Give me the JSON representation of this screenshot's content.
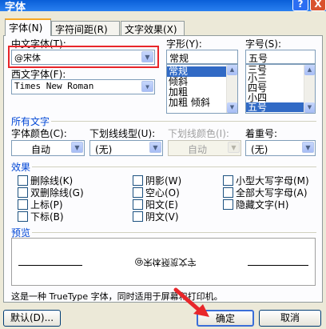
{
  "window": {
    "title": "字体",
    "help": "?",
    "close": "X"
  },
  "tabs": [
    "字体(N)",
    "字符间距(R)",
    "文字效果(X)"
  ],
  "labels": {
    "chinese_font": "中文字体(T):",
    "western_font": "西文字体(F):",
    "font_style": "字形(Y):",
    "font_size": "字号(S):",
    "all_text": "所有文字",
    "font_color": "字体颜色(C):",
    "underline_type": "下划线线型(U):",
    "underline_color": "下划线颜色(I):",
    "emphasis": "着重号:",
    "effects": "效果",
    "preview": "预览"
  },
  "fields": {
    "chinese_font": "@宋体",
    "western_font": "Times New Roman",
    "font_style": "常规",
    "font_size": "五号",
    "font_color": "自动",
    "underline_type": "(无)",
    "underline_color": "自动",
    "emphasis": "(无)"
  },
  "style_list": [
    {
      "label": "常规",
      "selected": true
    },
    {
      "label": "倾斜",
      "selected": false
    },
    {
      "label": "加粗",
      "selected": false
    },
    {
      "label": "加粗 倾斜",
      "selected": false
    }
  ],
  "size_list": [
    {
      "label": "三号",
      "selected": false
    },
    {
      "label": "小三",
      "selected": false
    },
    {
      "label": "四号",
      "selected": false
    },
    {
      "label": "小四",
      "selected": false
    },
    {
      "label": "五号",
      "selected": true
    }
  ],
  "effects": {
    "col1": [
      "删除线(K)",
      "双删除线(G)",
      "上标(P)",
      "下标(B)"
    ],
    "col2": [
      "阴影(W)",
      "空心(O)",
      "阳文(E)",
      "阴文(V)"
    ],
    "col3": [
      "小型大写字母(M)",
      "全部大写字母(A)",
      "隐藏文字(H)"
    ]
  },
  "preview_text": "@宋体预览文字",
  "status_text": "这是一种 TrueType 字体，同时适用于屏幕和打印机。",
  "buttons": {
    "default": "默认(D)...",
    "ok": "确定",
    "cancel": "取消"
  },
  "colors": {
    "accent": "#316ac5",
    "highlight": "#e8262a",
    "title_bar": "#0a5fd8"
  }
}
